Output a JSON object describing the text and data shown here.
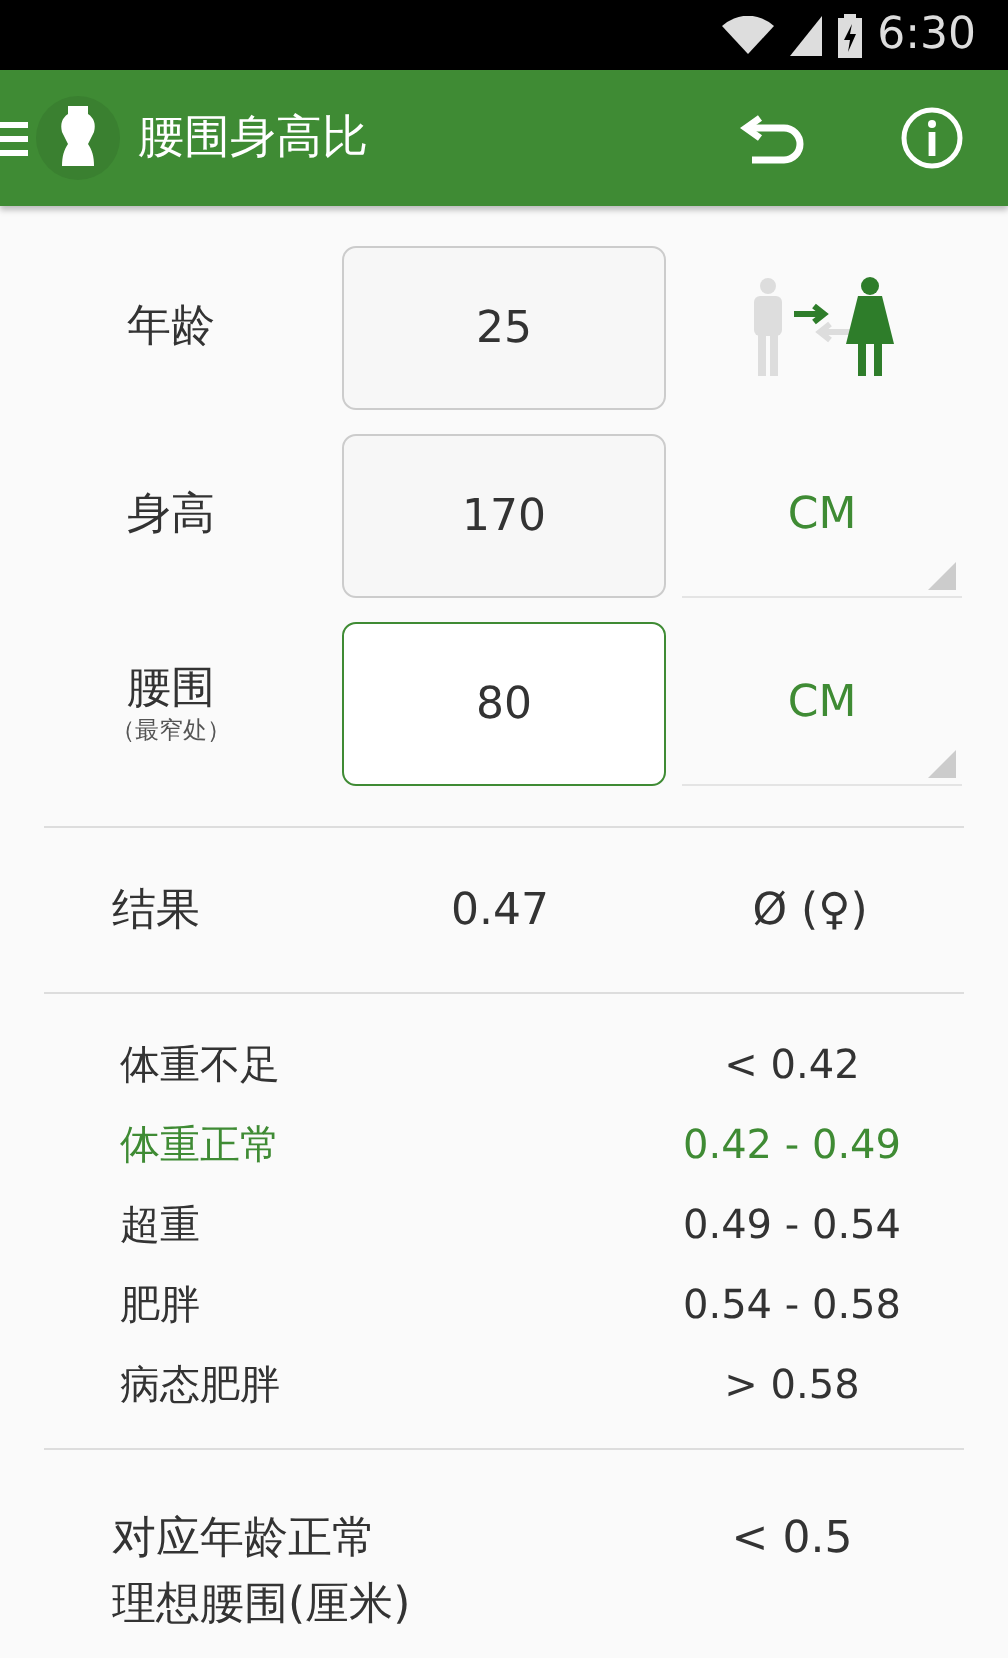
{
  "status_bar": {
    "time": "6:30"
  },
  "toolbar": {
    "title": "腰围身高比"
  },
  "inputs": [
    {
      "kind": "gender",
      "label": "年龄",
      "value": "25",
      "focused": false,
      "female": true
    },
    {
      "kind": "unit",
      "label": "身高",
      "value": "170",
      "focused": false,
      "unit": "CM"
    },
    {
      "kind": "unit",
      "label": "腰围",
      "sublabel": "（最窄处）",
      "value": "80",
      "focused": true,
      "unit": "CM"
    }
  ],
  "result": {
    "label": "结果",
    "value": "0.47",
    "note": "Ø (♀)"
  },
  "categories": [
    {
      "label": "体重不足",
      "range": "< 0.42",
      "selected": false
    },
    {
      "label": "体重正常",
      "range": "0.42 - 0.49",
      "selected": true
    },
    {
      "label": "超重",
      "range": "0.49 - 0.54",
      "selected": false
    },
    {
      "label": "肥胖",
      "range": "0.54 - 0.58",
      "selected": false
    },
    {
      "label": "病态肥胖",
      "range": "> 0.58",
      "selected": false
    }
  ],
  "ideal": {
    "label_lines": [
      "对应年龄正常",
      "理想腰围(厘米)"
    ],
    "value": "< 0.5"
  }
}
